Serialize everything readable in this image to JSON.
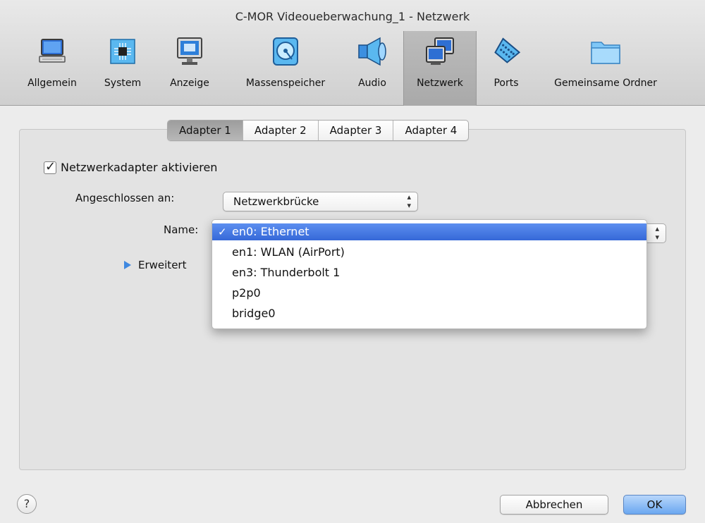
{
  "window": {
    "title": "C-MOR Videoueberwachung_1 - Netzwerk"
  },
  "toolbar": {
    "items": [
      {
        "label": "Allgemein",
        "icon": "general-icon"
      },
      {
        "label": "System",
        "icon": "chip-icon"
      },
      {
        "label": "Anzeige",
        "icon": "monitor-icon"
      },
      {
        "label": "Massenspeicher",
        "icon": "disk-icon"
      },
      {
        "label": "Audio",
        "icon": "speaker-icon"
      },
      {
        "label": "Netzwerk",
        "icon": "network-icon"
      },
      {
        "label": "Ports",
        "icon": "serial-port-icon"
      },
      {
        "label": "Gemeinsame Ordner",
        "icon": "folder-icon"
      }
    ],
    "active": "Netzwerk"
  },
  "tabs": [
    {
      "label": "Adapter 1"
    },
    {
      "label": "Adapter 2"
    },
    {
      "label": "Adapter 3"
    },
    {
      "label": "Adapter 4"
    }
  ],
  "adapter": {
    "enable_label": "Netzwerkadapter aktivieren",
    "enabled": true,
    "attached_label": "Angeschlossen an:",
    "attached_value": "Netzwerkbrücke",
    "name_label": "Name:",
    "advanced_label": "Erweitert"
  },
  "name_menu": {
    "options": [
      "en0: Ethernet",
      "en1: WLAN (AirPort)",
      "en3: Thunderbolt 1",
      "p2p0",
      "bridge0"
    ],
    "selected_index": 0
  },
  "footer": {
    "help_label": "?",
    "cancel_label": "Abbrechen",
    "ok_label": "OK"
  },
  "colors": {
    "selection": "#3568d8",
    "accent": "#3f88e0"
  }
}
